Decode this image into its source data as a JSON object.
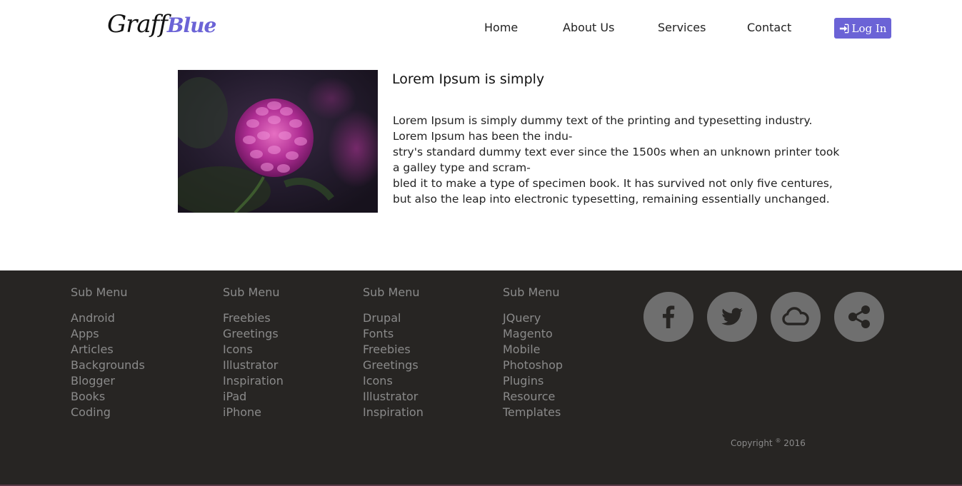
{
  "header": {
    "logo_part1": "Graff",
    "logo_part2": "Blue",
    "nav": [
      "Home",
      "About Us",
      "Services",
      "Contact"
    ],
    "login_label": "Log In",
    "login_icon": "sign-in-icon"
  },
  "article": {
    "image_subject": "pink dahlia flower",
    "title": "Lorem Ipsum is simply",
    "lines": [
      "Lorem Ipsum is simply dummy text of the printing and typesetting industry.",
      "Lorem Ipsum has been the indu-",
      "stry's standard dummy text ever since the 1500s when an unknown printer took",
      "a galley type and scram-",
      "bled it to make a type of specimen book. It has survived not only five centures,",
      "but also the leap into electronic typesetting, remaining essentially unchanged."
    ]
  },
  "footer": {
    "columns": [
      {
        "heading": "Sub Menu",
        "items": [
          "Android",
          "Apps",
          "Articles",
          "Backgrounds",
          "Blogger",
          "Books",
          "Coding"
        ]
      },
      {
        "heading": "Sub Menu",
        "items": [
          "Freebies",
          "Greetings",
          "Icons",
          "Illustrator",
          "Inspiration",
          "iPad",
          "iPhone"
        ]
      },
      {
        "heading": "Sub Menu",
        "items": [
          "Drupal",
          "Fonts",
          "Freebies",
          "Greetings",
          "Icons",
          "Illustrator",
          "Inspiration"
        ]
      },
      {
        "heading": "Sub Menu",
        "items": [
          "JQuery",
          "Magento",
          "Mobile",
          "Photoshop",
          "Plugins",
          "Resource",
          "Templates"
        ]
      }
    ],
    "social_icons": [
      "facebook-icon",
      "twitter-icon",
      "cloud-icon",
      "share-icon"
    ],
    "copyright_text": "Copyright",
    "copyright_symbol": "®",
    "copyright_year": "2016"
  },
  "colors": {
    "accent": "#6b63d6",
    "footer_bg": "#272523",
    "footer_text": "#8a8a8a",
    "social_bg": "#6f6f6f"
  }
}
